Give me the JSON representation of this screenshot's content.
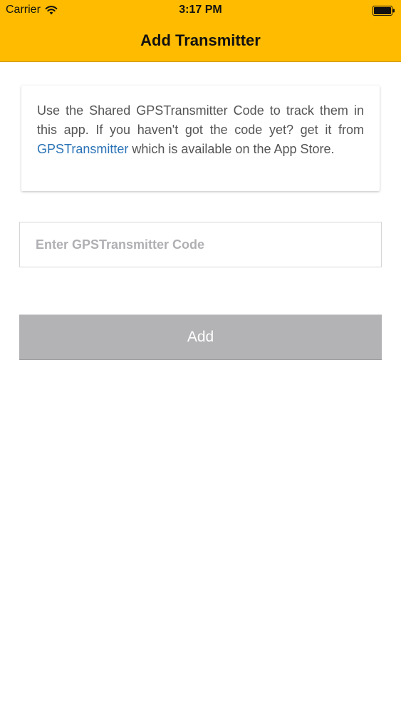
{
  "status_bar": {
    "carrier": "Carrier",
    "time": "3:17 PM"
  },
  "nav": {
    "title": "Add Transmitter"
  },
  "info": {
    "text_before": "Use the Shared GPSTransmitter Code to track them in this app. If you haven't got the code yet? get it from ",
    "link_text": "GPSTransmitter",
    "text_after": " which is available on the App Store."
  },
  "code_input": {
    "placeholder": "Enter GPSTransmitter Code",
    "value": ""
  },
  "add_button": {
    "label": "Add"
  },
  "colors": {
    "nav_background": "#FFBB00",
    "link": "#2B73B6",
    "button_disabled": "#B3B3B5"
  },
  "icons": {
    "wifi": "wifi-icon",
    "battery": "battery-icon"
  }
}
